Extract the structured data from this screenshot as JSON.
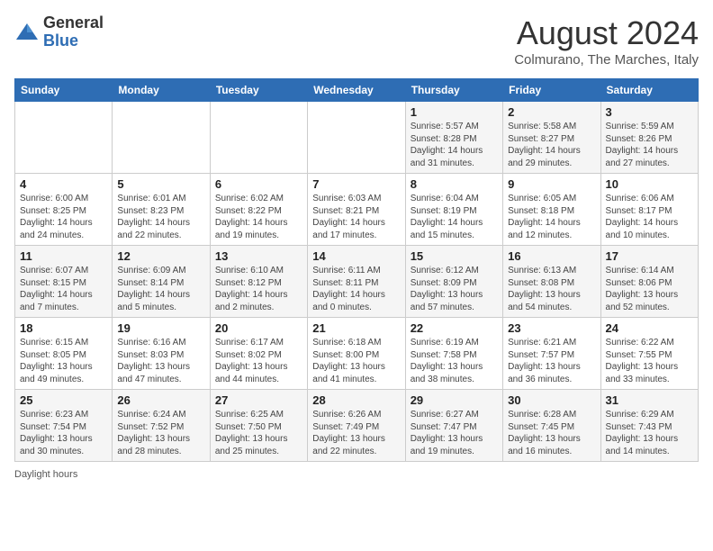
{
  "header": {
    "logo_general": "General",
    "logo_blue": "Blue",
    "title": "August 2024",
    "subtitle": "Colmurano, The Marches, Italy"
  },
  "days_of_week": [
    "Sunday",
    "Monday",
    "Tuesday",
    "Wednesday",
    "Thursday",
    "Friday",
    "Saturday"
  ],
  "weeks": [
    [
      {
        "day": "",
        "info": ""
      },
      {
        "day": "",
        "info": ""
      },
      {
        "day": "",
        "info": ""
      },
      {
        "day": "",
        "info": ""
      },
      {
        "day": "1",
        "info": "Sunrise: 5:57 AM\nSunset: 8:28 PM\nDaylight: 14 hours and 31 minutes."
      },
      {
        "day": "2",
        "info": "Sunrise: 5:58 AM\nSunset: 8:27 PM\nDaylight: 14 hours and 29 minutes."
      },
      {
        "day": "3",
        "info": "Sunrise: 5:59 AM\nSunset: 8:26 PM\nDaylight: 14 hours and 27 minutes."
      }
    ],
    [
      {
        "day": "4",
        "info": "Sunrise: 6:00 AM\nSunset: 8:25 PM\nDaylight: 14 hours and 24 minutes."
      },
      {
        "day": "5",
        "info": "Sunrise: 6:01 AM\nSunset: 8:23 PM\nDaylight: 14 hours and 22 minutes."
      },
      {
        "day": "6",
        "info": "Sunrise: 6:02 AM\nSunset: 8:22 PM\nDaylight: 14 hours and 19 minutes."
      },
      {
        "day": "7",
        "info": "Sunrise: 6:03 AM\nSunset: 8:21 PM\nDaylight: 14 hours and 17 minutes."
      },
      {
        "day": "8",
        "info": "Sunrise: 6:04 AM\nSunset: 8:19 PM\nDaylight: 14 hours and 15 minutes."
      },
      {
        "day": "9",
        "info": "Sunrise: 6:05 AM\nSunset: 8:18 PM\nDaylight: 14 hours and 12 minutes."
      },
      {
        "day": "10",
        "info": "Sunrise: 6:06 AM\nSunset: 8:17 PM\nDaylight: 14 hours and 10 minutes."
      }
    ],
    [
      {
        "day": "11",
        "info": "Sunrise: 6:07 AM\nSunset: 8:15 PM\nDaylight: 14 hours and 7 minutes."
      },
      {
        "day": "12",
        "info": "Sunrise: 6:09 AM\nSunset: 8:14 PM\nDaylight: 14 hours and 5 minutes."
      },
      {
        "day": "13",
        "info": "Sunrise: 6:10 AM\nSunset: 8:12 PM\nDaylight: 14 hours and 2 minutes."
      },
      {
        "day": "14",
        "info": "Sunrise: 6:11 AM\nSunset: 8:11 PM\nDaylight: 14 hours and 0 minutes."
      },
      {
        "day": "15",
        "info": "Sunrise: 6:12 AM\nSunset: 8:09 PM\nDaylight: 13 hours and 57 minutes."
      },
      {
        "day": "16",
        "info": "Sunrise: 6:13 AM\nSunset: 8:08 PM\nDaylight: 13 hours and 54 minutes."
      },
      {
        "day": "17",
        "info": "Sunrise: 6:14 AM\nSunset: 8:06 PM\nDaylight: 13 hours and 52 minutes."
      }
    ],
    [
      {
        "day": "18",
        "info": "Sunrise: 6:15 AM\nSunset: 8:05 PM\nDaylight: 13 hours and 49 minutes."
      },
      {
        "day": "19",
        "info": "Sunrise: 6:16 AM\nSunset: 8:03 PM\nDaylight: 13 hours and 47 minutes."
      },
      {
        "day": "20",
        "info": "Sunrise: 6:17 AM\nSunset: 8:02 PM\nDaylight: 13 hours and 44 minutes."
      },
      {
        "day": "21",
        "info": "Sunrise: 6:18 AM\nSunset: 8:00 PM\nDaylight: 13 hours and 41 minutes."
      },
      {
        "day": "22",
        "info": "Sunrise: 6:19 AM\nSunset: 7:58 PM\nDaylight: 13 hours and 38 minutes."
      },
      {
        "day": "23",
        "info": "Sunrise: 6:21 AM\nSunset: 7:57 PM\nDaylight: 13 hours and 36 minutes."
      },
      {
        "day": "24",
        "info": "Sunrise: 6:22 AM\nSunset: 7:55 PM\nDaylight: 13 hours and 33 minutes."
      }
    ],
    [
      {
        "day": "25",
        "info": "Sunrise: 6:23 AM\nSunset: 7:54 PM\nDaylight: 13 hours and 30 minutes."
      },
      {
        "day": "26",
        "info": "Sunrise: 6:24 AM\nSunset: 7:52 PM\nDaylight: 13 hours and 28 minutes."
      },
      {
        "day": "27",
        "info": "Sunrise: 6:25 AM\nSunset: 7:50 PM\nDaylight: 13 hours and 25 minutes."
      },
      {
        "day": "28",
        "info": "Sunrise: 6:26 AM\nSunset: 7:49 PM\nDaylight: 13 hours and 22 minutes."
      },
      {
        "day": "29",
        "info": "Sunrise: 6:27 AM\nSunset: 7:47 PM\nDaylight: 13 hours and 19 minutes."
      },
      {
        "day": "30",
        "info": "Sunrise: 6:28 AM\nSunset: 7:45 PM\nDaylight: 13 hours and 16 minutes."
      },
      {
        "day": "31",
        "info": "Sunrise: 6:29 AM\nSunset: 7:43 PM\nDaylight: 13 hours and 14 minutes."
      }
    ]
  ],
  "footer": "Daylight hours"
}
